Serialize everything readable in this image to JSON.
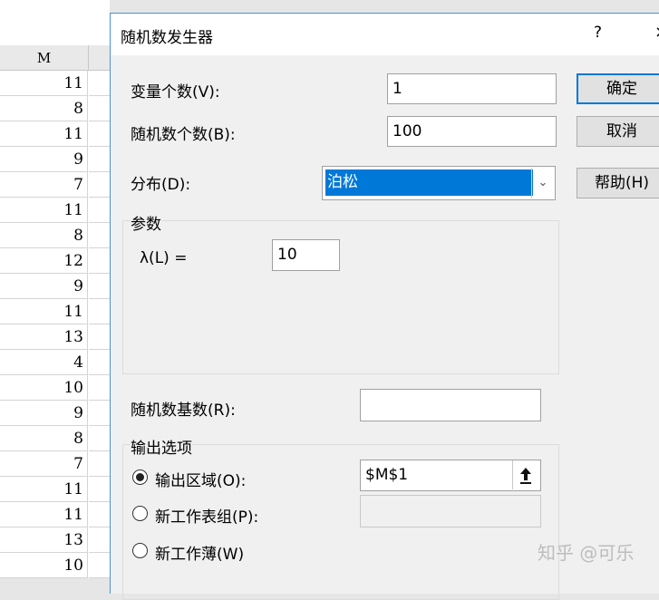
{
  "sheet": {
    "column_header": "M",
    "cells": [
      "11",
      "8",
      "11",
      "9",
      "7",
      "11",
      "8",
      "12",
      "9",
      "11",
      "13",
      "4",
      "10",
      "9",
      "8",
      "7",
      "11",
      "11",
      "13",
      "10"
    ]
  },
  "dialog": {
    "title": "随机数发生器",
    "help_glyph": "?",
    "close_glyph": "×",
    "variables_label": "变量个数(V):",
    "variables_value": "1",
    "count_label": "随机数个数(B):",
    "count_value": "100",
    "distribution_label": "分布(D):",
    "distribution_value": "泊松",
    "params_title": "参数",
    "lambda_label": "λ(L) =",
    "lambda_value": "10",
    "seed_label": "随机数基数(R):",
    "seed_value": "",
    "output_title": "输出选项",
    "output_range_label": "输出区域(O):",
    "output_range_value": "$M$1",
    "new_sheet_label": "新工作表组(P):",
    "new_sheet_value": "",
    "new_book_label": "新工作薄(W)",
    "ok_label": "确定",
    "cancel_label": "取消",
    "help_label": "帮助(H)",
    "selected_output": "output_range"
  },
  "watermark": "知乎 @可乐"
}
